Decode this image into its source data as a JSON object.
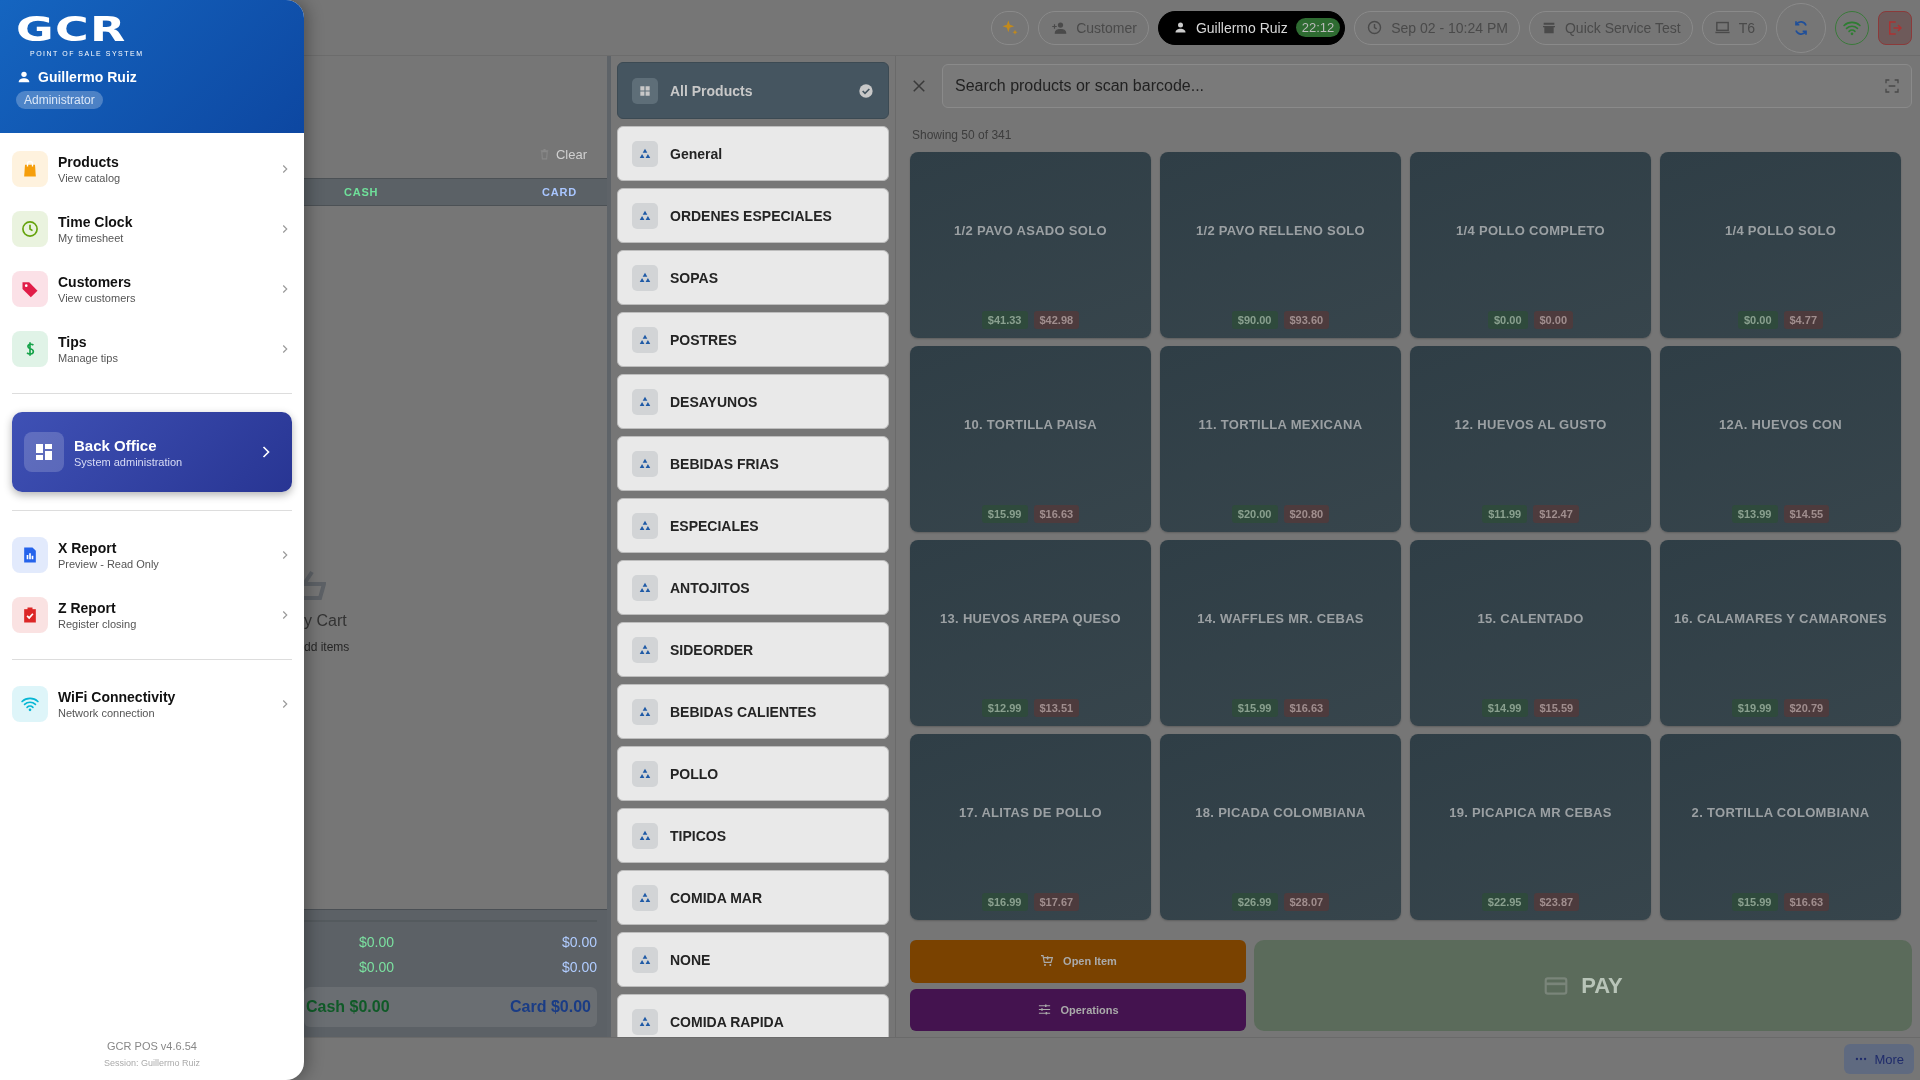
{
  "drawer": {
    "logo": "GCR",
    "tagline": "POINT OF SALE SYSTEM",
    "user": "Guillermo Ruiz",
    "role": "Administrator",
    "sections": [
      [
        {
          "title": "Products",
          "subtitle": "View catalog",
          "color": "#f59e0b",
          "kind": "plain"
        },
        {
          "title": "Time Clock",
          "subtitle": "My timesheet",
          "color": "#65a30d",
          "kind": "plain"
        },
        {
          "title": "Customers",
          "subtitle": "View customers",
          "color": "#e11d48",
          "kind": "plain"
        },
        {
          "title": "Tips",
          "subtitle": "Manage tips",
          "color": "#16a34a",
          "kind": "plain"
        }
      ],
      [
        {
          "title": "Back Office",
          "subtitle": "System administration",
          "color": "#ffffff",
          "kind": "featured"
        }
      ],
      [
        {
          "title": "X Report",
          "subtitle": "Preview - Read Only",
          "color": "#2563eb",
          "kind": "plain"
        },
        {
          "title": "Z Report",
          "subtitle": "Register closing",
          "color": "#dc2626",
          "kind": "plain"
        }
      ],
      [
        {
          "title": "WiFi Connectivity",
          "subtitle": "Network connection",
          "color": "#06b6d4",
          "kind": "plain"
        }
      ]
    ],
    "version": "GCR POS v4.6.54",
    "session": "Session: Guillermo Ruiz"
  },
  "top_bar": {
    "customer_button": "Customer",
    "user": {
      "name": "Guillermo Ruiz",
      "time": "22:12"
    },
    "date_time": "Sep 02 - 10:24 PM",
    "mode": "Quick Service Test",
    "terminal": "T6"
  },
  "cart": {
    "clear_button": "Clear",
    "columns": [
      "CASH",
      "CARD"
    ],
    "empty_title": "y Cart",
    "empty_hint": "dd items",
    "totals": [
      {
        "cash": "$0.00",
        "card": "$0.00"
      },
      {
        "cash": "$0.00",
        "card": "$0.00"
      }
    ],
    "total_cash": "Cash $0.00",
    "total_card": "Card $0.00"
  },
  "categories": [
    {
      "label": "All Products",
      "selected": true
    },
    {
      "label": "General",
      "selected": false
    },
    {
      "label": "ORDENES ESPECIALES",
      "selected": false
    },
    {
      "label": "SOPAS",
      "selected": false
    },
    {
      "label": "POSTRES",
      "selected": false
    },
    {
      "label": "DESAYUNOS",
      "selected": false
    },
    {
      "label": "BEBIDAS FRIAS",
      "selected": false
    },
    {
      "label": "ESPECIALES",
      "selected": false
    },
    {
      "label": "ANTOJITOS",
      "selected": false
    },
    {
      "label": "SIDEORDER",
      "selected": false
    },
    {
      "label": "BEBIDAS CALIENTES",
      "selected": false
    },
    {
      "label": "POLLO",
      "selected": false
    },
    {
      "label": "TIPICOS",
      "selected": false
    },
    {
      "label": "COMIDA MAR",
      "selected": false
    },
    {
      "label": "NONE",
      "selected": false
    },
    {
      "label": "COMIDA RAPIDA",
      "selected": false
    }
  ],
  "products": {
    "search": {
      "placeholder": "Search products or scan barcode..."
    },
    "count": "Showing 50 of 341",
    "items": [
      {
        "name": "1/2 PAVO ASADO SOLO",
        "cash_price": "$41.33",
        "card_price": "$42.98"
      },
      {
        "name": "1/2 PAVO RELLENO SOLO",
        "cash_price": "$90.00",
        "card_price": "$93.60"
      },
      {
        "name": "1/4 POLLO COMPLETO",
        "cash_price": "$0.00",
        "card_price": "$0.00"
      },
      {
        "name": "1/4 POLLO SOLO",
        "cash_price": "$0.00",
        "card_price": "$4.77"
      },
      {
        "name": "10. TORTILLA PAISA",
        "cash_price": "$15.99",
        "card_price": "$16.63"
      },
      {
        "name": "11. TORTILLA MEXICANA",
        "cash_price": "$20.00",
        "card_price": "$20.80"
      },
      {
        "name": "12. HUEVOS AL GUSTO",
        "cash_price": "$11.99",
        "card_price": "$12.47"
      },
      {
        "name": "12A. HUEVOS CON",
        "cash_price": "$13.99",
        "card_price": "$14.55"
      },
      {
        "name": "13. HUEVOS AREPA QUESO",
        "cash_price": "$12.99",
        "card_price": "$13.51"
      },
      {
        "name": "14. WAFFLES MR. CEBAS",
        "cash_price": "$15.99",
        "card_price": "$16.63"
      },
      {
        "name": "15. CALENTADO",
        "cash_price": "$14.99",
        "card_price": "$15.59"
      },
      {
        "name": "16. CALAMARES Y CAMARONES",
        "cash_price": "$19.99",
        "card_price": "$20.79"
      },
      {
        "name": "17. ALITAS DE POLLO",
        "cash_price": "$16.99",
        "card_price": "$17.67"
      },
      {
        "name": "18. PICADA COLOMBIANA",
        "cash_price": "$26.99",
        "card_price": "$28.07"
      },
      {
        "name": "19. PICAPICA MR CEBAS",
        "cash_price": "$22.95",
        "card_price": "$23.87"
      },
      {
        "name": "2. TORTILLA COLOMBIANA",
        "cash_price": "$15.99",
        "card_price": "$16.63"
      }
    ]
  },
  "actions": {
    "open_item": "Open Item",
    "operations": "Operations",
    "pay": "PAY"
  },
  "footer": {
    "more_button": "More"
  }
}
